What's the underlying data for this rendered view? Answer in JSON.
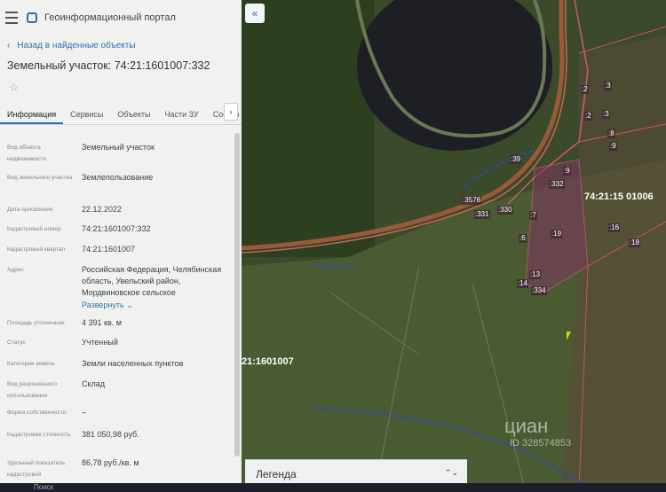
{
  "app": {
    "title": "Геоинформационный портал"
  },
  "nav": {
    "back_label": "Назад в найденные объекты"
  },
  "parcel": {
    "title": "Земельный участок: 74:21:1601007:332"
  },
  "tabs": [
    {
      "label": "Информация",
      "active": true
    },
    {
      "label": "Сервисы"
    },
    {
      "label": "Объекты"
    },
    {
      "label": "Части ЗУ"
    },
    {
      "label": "Состав"
    }
  ],
  "properties": [
    {
      "label": "Вид объекта недвижимости",
      "value": "Земельный участок"
    },
    {
      "label": "Вид земельного участка",
      "value": "Землепользование"
    },
    {
      "label": "Дата присвоения",
      "value": "22.12.2022"
    },
    {
      "label": "Кадастровый номер",
      "value": "74:21:1601007:332"
    },
    {
      "label": "Кадастровый квартал",
      "value": "74:21:1601007"
    },
    {
      "label": "Адрес",
      "value": "Российская Федерация, Челябинская область, Увельский район, Мордвиновское сельское",
      "expand_label": "Развернуть"
    },
    {
      "label": "Площадь уточненная",
      "value": "4 391 кв. м"
    },
    {
      "label": "Статус",
      "value": "Учтенный"
    },
    {
      "label": "Категория земель",
      "value": "Земли населенных пунктов"
    },
    {
      "label": "Вид разрешенного использования",
      "value": "Склад"
    },
    {
      "label": "Форма собственности",
      "value": "–"
    },
    {
      "label": "Кадастровая стоимость",
      "value": "381 050,98 руб."
    },
    {
      "label": "Удельный показатель кадастровой",
      "value": "86,78 руб./кв. м"
    }
  ],
  "legend": {
    "label": "Легенда"
  },
  "taskbar": {
    "search_label": "Поиск"
  },
  "map": {
    "quarter_label_right": "74:21:15 01006",
    "quarter_label_left": "21:1601007",
    "parcel_labels": [
      ":2",
      ":3",
      ":2",
      ":3",
      ":8",
      ":9",
      ":39",
      ":9",
      ":332",
      ":3576",
      ":331",
      ":330",
      ":7",
      ":16",
      ":18",
      ":6",
      ":19",
      ":13",
      ":14",
      ":334"
    ],
    "watermark": "циан",
    "watermark_id": "ID 328574853"
  }
}
